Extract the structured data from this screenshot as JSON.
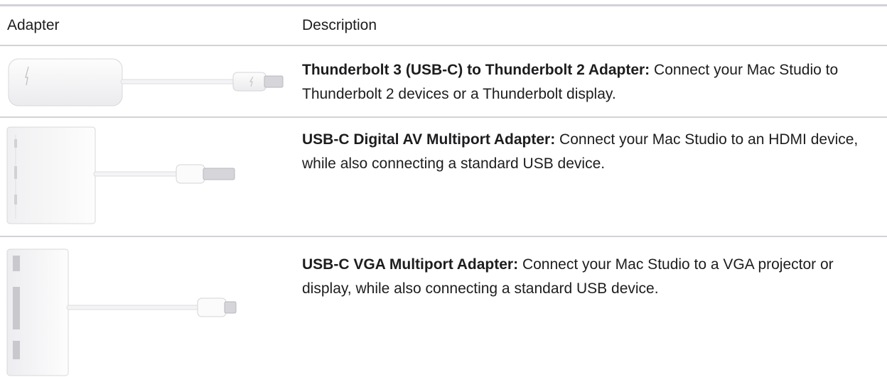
{
  "table": {
    "headers": {
      "adapter": "Adapter",
      "description": "Description"
    },
    "rows": [
      {
        "image": "thunderbolt-3-to-thunderbolt-2-adapter-image",
        "name": "Thunderbolt 3 (USB-C) to Thunderbolt 2 Adapter:",
        "text": "Connect your Mac Studio to Thunderbolt 2 devices or a Thunderbolt display."
      },
      {
        "image": "usb-c-digital-av-multiport-adapter-image",
        "name": "USB-C Digital AV Multiport Adapter:",
        "text": "Connect your Mac Studio to an HDMI device, while also connecting a standard USB device."
      },
      {
        "image": "usb-c-vga-multiport-adapter-image",
        "name": "USB-C VGA Multiport Adapter:",
        "text": "Connect your Mac Studio to a VGA projector or display, while also connecting a standard USB device."
      }
    ]
  },
  "colors": {
    "rule": "#d2d2d7",
    "text": "#1d1d1f",
    "device": "#f7f7f8",
    "device_edge": "#d8d8dc"
  }
}
